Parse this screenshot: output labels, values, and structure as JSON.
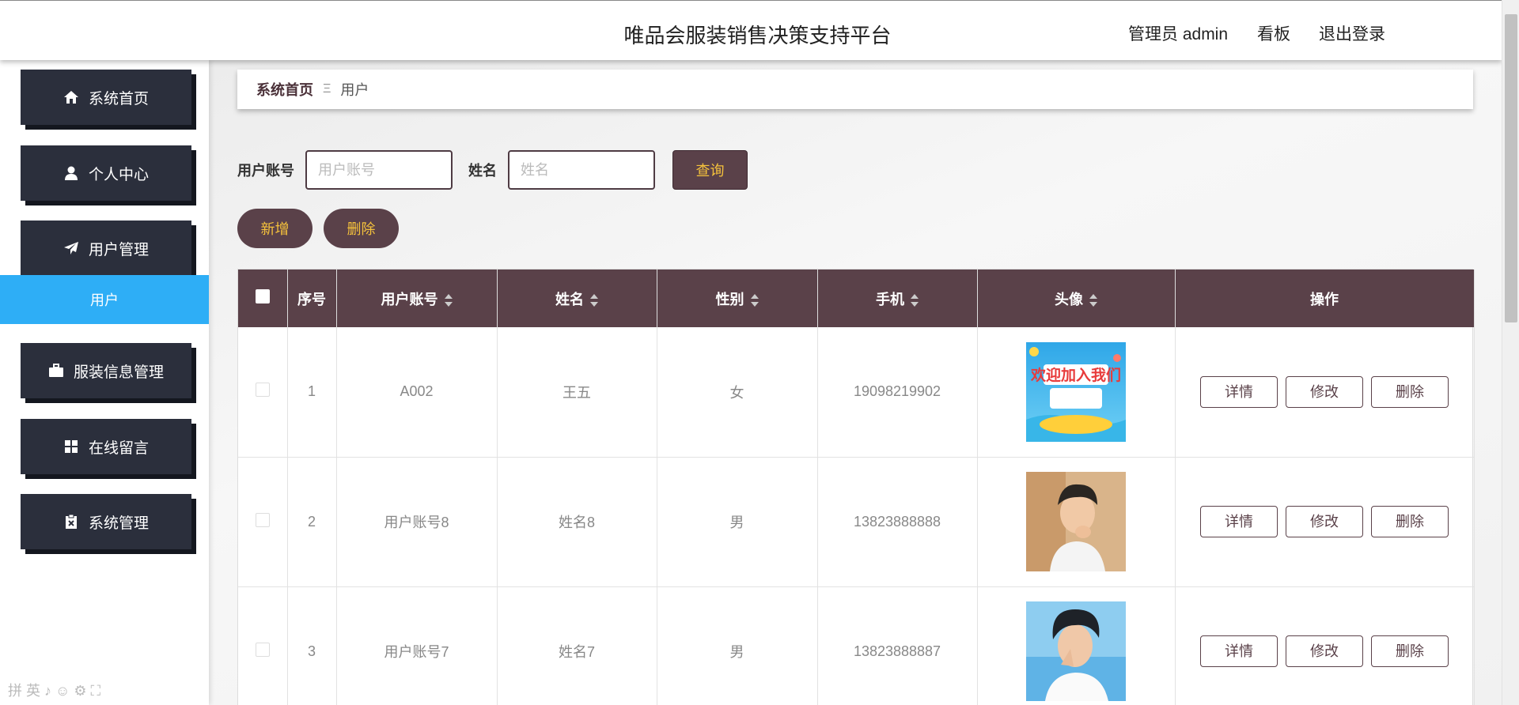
{
  "header": {
    "title": "唯品会服装销售决策支持平台",
    "admin": "管理员 admin",
    "board": "看板",
    "logout": "退出登录"
  },
  "sidebar": {
    "items": [
      {
        "label": "系统首页",
        "icon": "home-icon"
      },
      {
        "label": "个人中心",
        "icon": "user-icon"
      },
      {
        "label": "用户管理",
        "icon": "paper-plane-icon"
      },
      {
        "label": "服装信息管理",
        "icon": "briefcase-icon"
      },
      {
        "label": "在线留言",
        "icon": "grid-icon"
      },
      {
        "label": "系统管理",
        "icon": "clipboard-icon"
      }
    ],
    "active_sub": "用户",
    "ime_bar": "拼 英 ♪ ☺ ⚙ ⛶"
  },
  "breadcrumb": {
    "home": "系统首页",
    "sep": "Ξ",
    "current": "用户"
  },
  "search": {
    "account_label": "用户账号",
    "account_placeholder": "用户账号",
    "name_label": "姓名",
    "name_placeholder": "姓名",
    "query": "查询"
  },
  "actions": {
    "add": "新增",
    "delete": "删除"
  },
  "table": {
    "headers": {
      "index": "序号",
      "account": "用户账号",
      "name": "姓名",
      "gender": "性别",
      "phone": "手机",
      "avatar": "头像",
      "ops": "操作"
    },
    "rows": [
      {
        "index": "1",
        "account": "A002",
        "name": "王五",
        "gender": "女",
        "phone": "19098219902",
        "avatar_text": "欢迎加入我们"
      },
      {
        "index": "2",
        "account": "用户账号8",
        "name": "姓名8",
        "gender": "男",
        "phone": "13823888888"
      },
      {
        "index": "3",
        "account": "用户账号7",
        "name": "姓名7",
        "gender": "男",
        "phone": "13823888887"
      }
    ],
    "op_labels": {
      "detail": "详情",
      "edit": "修改",
      "delete": "删除"
    }
  }
}
